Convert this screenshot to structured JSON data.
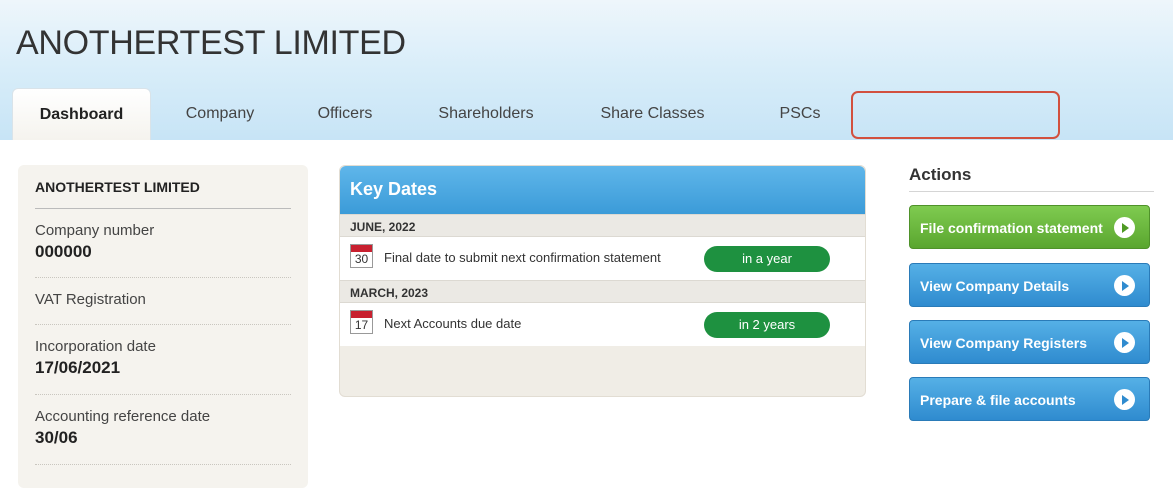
{
  "header": {
    "company_name": "ANOTHERTEST LIMITED"
  },
  "tabs": [
    {
      "label": "Dashboard",
      "active": true
    },
    {
      "label": "Company"
    },
    {
      "label": "Officers"
    },
    {
      "label": "Shareholders"
    },
    {
      "label": "Share Classes"
    },
    {
      "label": "PSCs"
    },
    {
      "label": ""
    }
  ],
  "summary": {
    "title": "ANOTHERTEST LIMITED",
    "rows": [
      {
        "label": "Company number",
        "value": "000000"
      },
      {
        "label": "VAT Registration",
        "value": ""
      },
      {
        "label": "Incorporation date",
        "value": "17/06/2021"
      },
      {
        "label": "Accounting reference date",
        "value": "30/06"
      }
    ]
  },
  "key_dates": {
    "title": "Key Dates",
    "groups": [
      {
        "month": "JUNE, 2022",
        "items": [
          {
            "day": "30",
            "desc": "Final date to submit next confirmation statement",
            "due": "in a year"
          }
        ]
      },
      {
        "month": "MARCH, 2023",
        "items": [
          {
            "day": "17",
            "desc": "Next Accounts due date",
            "due": "in 2 years"
          }
        ]
      }
    ]
  },
  "actions": {
    "title": "Actions",
    "buttons": [
      {
        "label": "File confirmation statement",
        "color": "green"
      },
      {
        "label": "View Company Details",
        "color": "blue"
      },
      {
        "label": "View Company Registers",
        "color": "blue"
      },
      {
        "label": "Prepare & file accounts",
        "color": "blue"
      }
    ]
  },
  "colors": {
    "header_bg": "#d8edf9",
    "accent_blue": "#3b9bd8",
    "green_pill": "#1e9140",
    "calendar_red": "#c8202f",
    "highlight": "#d2503e"
  }
}
